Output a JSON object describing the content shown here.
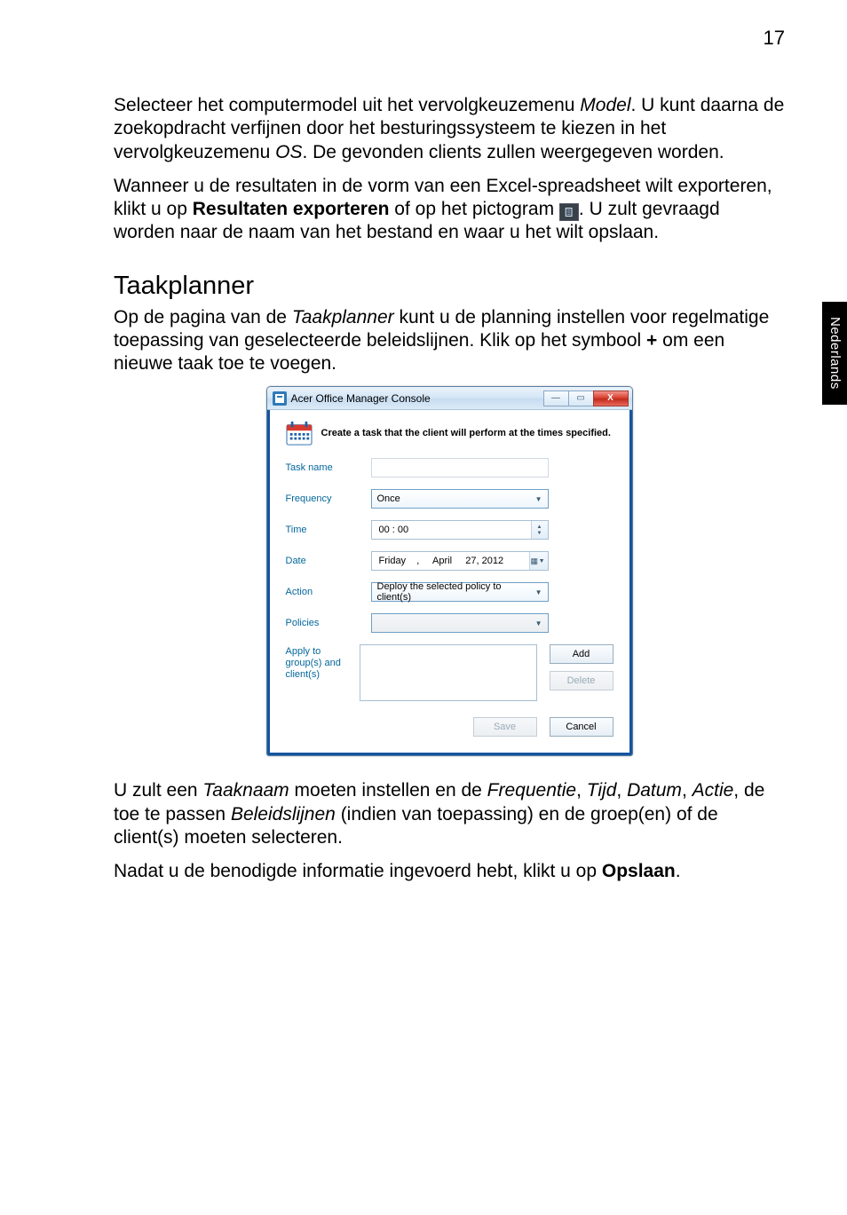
{
  "page_number": "17",
  "side_tab": "Nederlands",
  "para1": {
    "t1": "Selecteer het computermodel uit het vervolgkeuzemenu ",
    "i1": "Model",
    "t2": ". U kunt daarna de zoekopdracht verfijnen door het besturingssysteem te kiezen in het vervolgkeuzemenu ",
    "i2": "OS",
    "t3": ". De gevonden clients zullen weergegeven worden."
  },
  "para2": {
    "t1": "Wanneer u de resultaten in de vorm van een Excel-spreadsheet wilt exporteren, klikt u op ",
    "b1": "Resultaten exporteren",
    "t2": " of op het pictogram ",
    "t3": ". U zult gevraagd worden naar de naam van het bestand en waar u het wilt opslaan."
  },
  "heading": "Taakplanner",
  "para3": {
    "t1": "Op de pagina van de ",
    "i1": "Taakplanner",
    "t2": " kunt u de planning instellen voor regelmatige toepassing van geselecteerde beleidslijnen. Klik op het symbool ",
    "b1": "+",
    "t3": " om een nieuwe taak toe te voegen."
  },
  "dialog": {
    "title": "Acer Office Manager Console",
    "heading": "Create a task that the client will perform at the times specified.",
    "labels": {
      "task_name": "Task name",
      "frequency": "Frequency",
      "time": "Time",
      "date": "Date",
      "action": "Action",
      "policies": "Policies",
      "apply": "Apply to group(s) and client(s)"
    },
    "values": {
      "task_name": "",
      "frequency": "Once",
      "time": "00 : 00",
      "date": "Friday    ,     April     27, 2012",
      "action": "Deploy the selected policy to client(s)",
      "policies": ""
    },
    "buttons": {
      "add": "Add",
      "delete": "Delete",
      "save": "Save",
      "cancel": "Cancel"
    },
    "win_controls": {
      "min": "—",
      "max": "▭",
      "close": "X"
    }
  },
  "para4": {
    "t1": "U zult een ",
    "i1": "Taaknaam",
    "t2": " moeten instellen en de ",
    "i2": "Frequentie",
    "t3": ", ",
    "i3": "Tijd",
    "t4": ", ",
    "i4": "Datum",
    "t5": ", ",
    "i5": "Actie",
    "t6": ", de toe te passen ",
    "i6": "Beleidslijnen",
    "t7": " (indien van toepassing) en de groep(en) of de client(s) moeten selecteren."
  },
  "para5": {
    "t1": "Nadat u de benodigde informatie ingevoerd hebt, klikt u op ",
    "b1": "Opslaan",
    "t2": "."
  }
}
